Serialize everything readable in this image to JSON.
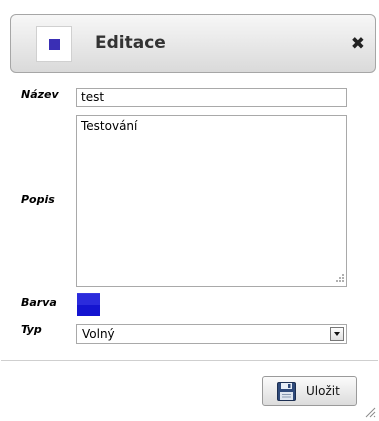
{
  "dialog": {
    "title": "Editace",
    "close_glyph": "✖"
  },
  "form": {
    "name_label": "Název",
    "name_value": "test",
    "description_label": "Popis",
    "description_value": "Testování",
    "color_label": "Barva",
    "color_value": "#1414d0",
    "type_label": "Typ",
    "type_value": "Volný"
  },
  "footer": {
    "save_label": "Uložit"
  },
  "colors": {
    "title_icon": "#3a2fb5",
    "swatch": "#1414d0",
    "save_icon": "#2f4a7a"
  },
  "icons": {
    "title": "square-icon",
    "close": "close-icon",
    "save": "floppy-disk-icon",
    "select_arrow": "chevron-down-icon",
    "resize": "resize-grip-icon"
  }
}
